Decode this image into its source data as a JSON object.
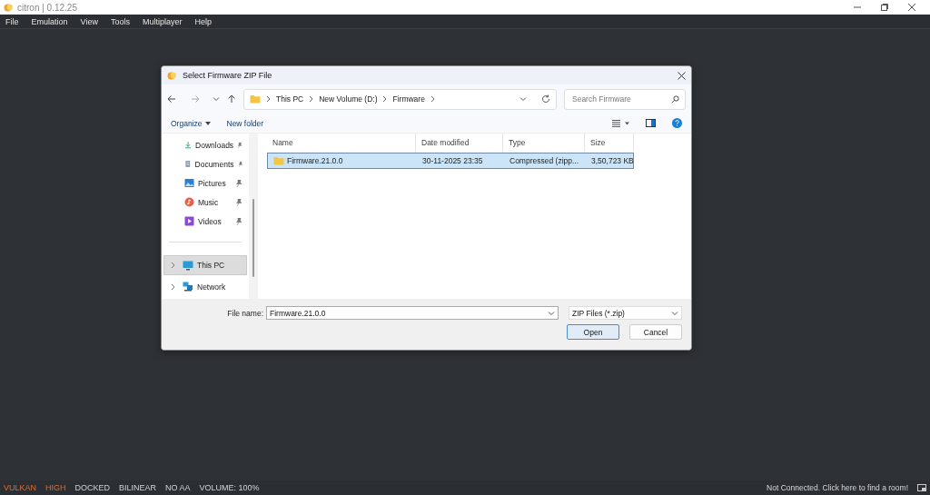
{
  "window": {
    "title": "citron | 0.12.25"
  },
  "menu": [
    "File",
    "Emulation",
    "View",
    "Tools",
    "Multiplayer",
    "Help"
  ],
  "dialog": {
    "title": "Select Firmware ZIP File",
    "breadcrumb": [
      "This PC",
      "New Volume (D:)",
      "Firmware"
    ],
    "search": {
      "placeholder": "Search Firmware"
    },
    "toolbar": [
      "Organize",
      "New folder"
    ],
    "sidebar": [
      {
        "label": "Downloads",
        "kind": "downloads",
        "pinned": true,
        "selected": false
      },
      {
        "label": "Documents",
        "kind": "documents",
        "pinned": true,
        "selected": false
      },
      {
        "label": "Pictures",
        "kind": "pictures",
        "pinned": true,
        "selected": false
      },
      {
        "label": "Music",
        "kind": "music",
        "pinned": true,
        "selected": false
      },
      {
        "label": "Videos",
        "kind": "videos",
        "pinned": true,
        "selected": false
      },
      {
        "label": "This PC",
        "kind": "pc",
        "pinned": false,
        "selected": true,
        "expandable": true
      },
      {
        "label": "Network",
        "kind": "network",
        "pinned": false,
        "selected": false,
        "expandable": true
      }
    ],
    "columns": [
      "Name",
      "Date modified",
      "Type",
      "Size"
    ],
    "rows": [
      {
        "cells": [
          "Firmware.21.0.0",
          "30-11-2025 23:35",
          "Compressed (zipp...",
          "3,50,723 KB"
        ],
        "selected": true
      }
    ],
    "file_name_label": "File name:",
    "file_name": "Firmware.21.0.0",
    "filter": "ZIP Files (*.zip)",
    "buttons": [
      "Open",
      "Cancel"
    ]
  },
  "status_bar": {
    "items": [
      {
        "text": "VULKAN",
        "highlighted": true
      },
      {
        "text": "HIGH",
        "highlighted": true
      },
      {
        "text": "DOCKED",
        "highlighted": false
      },
      {
        "text": "BILINEAR",
        "highlighted": false
      },
      {
        "text": "NO AA",
        "highlighted": false
      },
      {
        "text": "VOLUME: 100%",
        "highlighted": false
      }
    ],
    "network": "Not Connected. Click here to find a room!"
  }
}
